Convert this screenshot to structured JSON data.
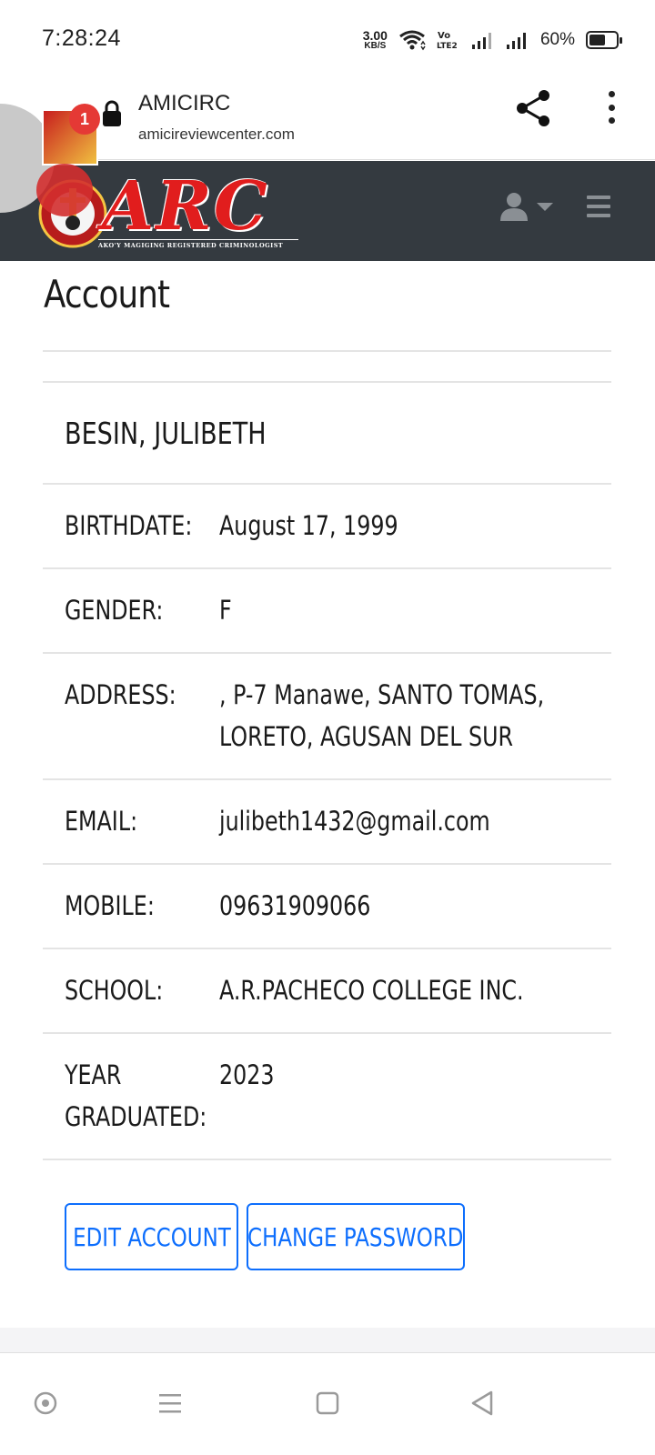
{
  "status_bar": {
    "time": "7:28:24",
    "speed_value": "3.00",
    "speed_unit": "KB/S",
    "volte": "Vo LTE2",
    "battery_percent": "60%",
    "battery_level": 0.6,
    "icons": [
      "wifi-icon",
      "volte-icon",
      "signal-icon",
      "signal-icon",
      "battery-icon"
    ]
  },
  "browser": {
    "site_title": "AMICIRC",
    "site_url": "amicireviewcenter.com",
    "icons": [
      "lock-icon",
      "share-icon",
      "more-icon"
    ]
  },
  "bubble": {
    "badge_count": "1"
  },
  "site_nav": {
    "logo_text": "ARC",
    "logo_tagline": "AKO'Y MAGIGING REGISTERED CRIMINOLOGIST",
    "icons": [
      "user-icon",
      "caret-down-icon",
      "hamburger-icon"
    ]
  },
  "page": {
    "title": "Account"
  },
  "profile": {
    "name": "BESIN, JULIBETH",
    "rows": [
      {
        "label": "BIRTHDATE:",
        "value": "August 17, 1999"
      },
      {
        "label": "GENDER:",
        "value": "F"
      },
      {
        "label": "ADDRESS:",
        "value": ", P-7 Manawe, SANTO TOMAS, LORETO, AGUSAN DEL SUR"
      },
      {
        "label": "EMAIL:",
        "value": "julibeth1432@gmail.com"
      },
      {
        "label": "MOBILE:",
        "value": "09631909066"
      },
      {
        "label": "SCHOOL:",
        "value": "A.R.PACHECO COLLEGE INC."
      },
      {
        "label": "YEAR GRADUATED:",
        "value": "2023"
      }
    ]
  },
  "actions": {
    "edit_label": "EDIT ACCOUNT",
    "change_password_label": "CHANGE PASSWORD"
  },
  "colors": {
    "navbar": "#343a40",
    "accent": "#0d6efd",
    "logo_red": "#e11d1d"
  },
  "android_nav": {
    "icons": [
      "assistant-icon",
      "recents-icon",
      "home-icon",
      "back-icon"
    ]
  }
}
